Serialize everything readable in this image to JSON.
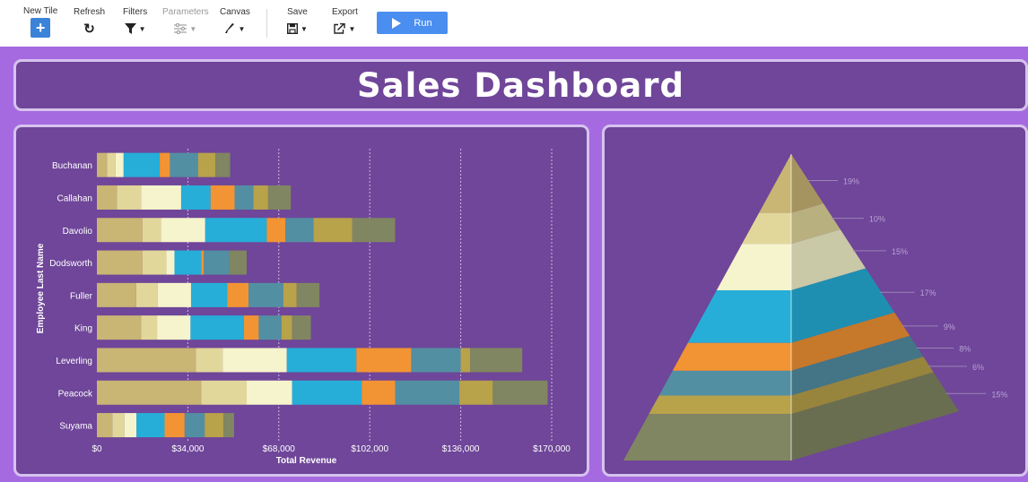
{
  "toolbar": {
    "new_tile": "New Tile",
    "refresh": "Refresh",
    "filters": "Filters",
    "parameters": "Parameters",
    "canvas": "Canvas",
    "save": "Save",
    "export": "Export",
    "run": "Run"
  },
  "dashboard": {
    "title": "Sales Dashboard"
  },
  "colors": {
    "toolbar_accent": "#3b82d9",
    "run_button": "#4a8ef0",
    "canvas_background": "#a56ae0",
    "panel_background": "#6f4699",
    "panel_border": "#d6c3ee"
  },
  "chart_data": [
    {
      "type": "bar",
      "orientation": "horizontal",
      "stacked": true,
      "xlabel": "Total Revenue",
      "ylabel": "Employee Last Name",
      "xlim": [
        0,
        170000
      ],
      "x_ticks": [
        "$0",
        "$34,000",
        "$68,000",
        "$102,000",
        "$136,000",
        "$170,000"
      ],
      "x_tick_values": [
        0,
        34000,
        68000,
        102000,
        136000,
        170000
      ],
      "grid": "vertical dotted",
      "categories": [
        "Buchanan",
        "Callahan",
        "Davolio",
        "Dodsworth",
        "Fuller",
        "King",
        "Leverling",
        "Peacock",
        "Suyama"
      ],
      "segment_colors": [
        "#c9b574",
        "#e2d79b",
        "#f5f4cc",
        "#26aed8",
        "#f29433",
        "#528fa3",
        "#b8a24a",
        "#808661"
      ],
      "series": [
        {
          "values": [
            3800,
            7500,
            17000,
            17000,
            14700,
            16500,
            37000,
            39000,
            5800
          ]
        },
        {
          "values": [
            3200,
            9000,
            7000,
            9000,
            8000,
            6000,
            10000,
            17000,
            4500
          ]
        },
        {
          "values": [
            3000,
            15000,
            16500,
            3000,
            12500,
            12500,
            24000,
            17000,
            4500
          ]
        },
        {
          "values": [
            13500,
            11000,
            23000,
            10000,
            13500,
            20000,
            26000,
            26000,
            10500
          ]
        },
        {
          "values": [
            3800,
            9000,
            7000,
            1000,
            8000,
            5500,
            20500,
            12500,
            7500
          ]
        },
        {
          "values": [
            10500,
            7000,
            10500,
            9500,
            13000,
            8500,
            18500,
            24000,
            7500
          ]
        },
        {
          "values": [
            6500,
            5500,
            14500,
            0,
            5000,
            4000,
            3500,
            12500,
            7000
          ]
        },
        {
          "values": [
            5500,
            8500,
            16000,
            6500,
            8500,
            7000,
            19500,
            20500,
            4000
          ]
        }
      ]
    },
    {
      "type": "pyramid",
      "slice_colors": [
        "#c9b574",
        "#e2d79b",
        "#f5f4cc",
        "#26aed8",
        "#f29433",
        "#528fa3",
        "#b8a24a",
        "#808661"
      ],
      "values": [
        19,
        10,
        15,
        17,
        9,
        8,
        6,
        15
      ],
      "labels": [
        "19%",
        "10%",
        "15%",
        "17%",
        "9%",
        "8%",
        "6%",
        "15%"
      ]
    }
  ]
}
